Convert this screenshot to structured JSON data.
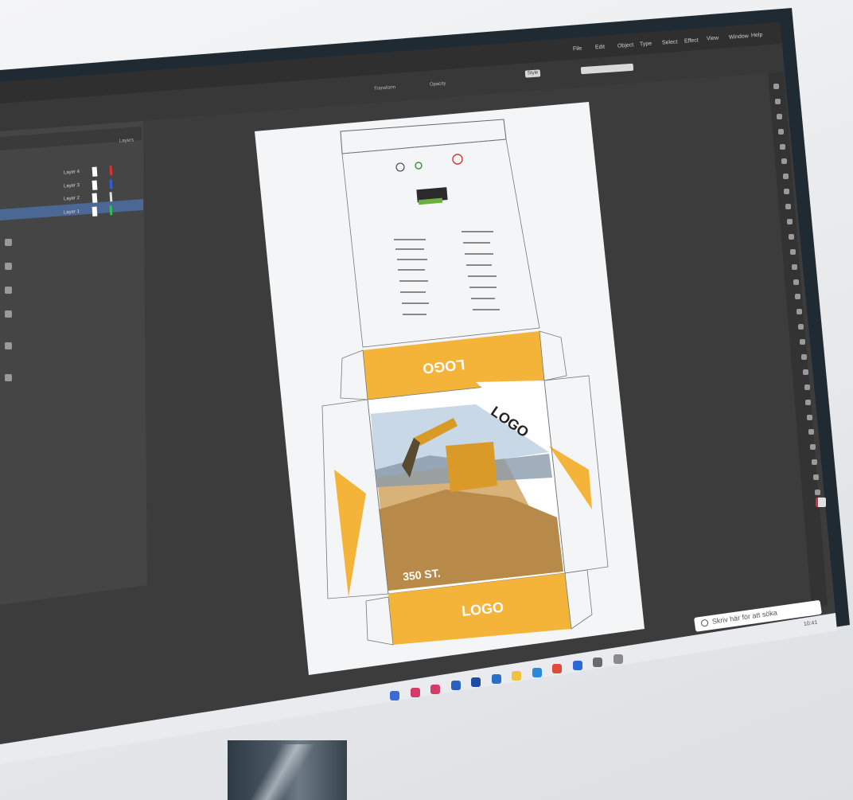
{
  "menu_items": [
    "File",
    "Edit",
    "Object",
    "Type",
    "Select",
    "Effect",
    "View",
    "Window",
    "Help"
  ],
  "control_bar": {
    "transform_label": "Transform",
    "opacity_label": "Opacity",
    "style_label": "Style"
  },
  "layers_panel": {
    "tab_label": "Layers",
    "layers": [
      {
        "name": "Layer 4",
        "color": "#e03030"
      },
      {
        "name": "Layer 3",
        "color": "#3060e0"
      },
      {
        "name": "Layer 2",
        "color": "#e0e0e0"
      },
      {
        "name": "Layer 1",
        "color": "#30c050"
      }
    ]
  },
  "artboard": {
    "top_logo": "LOGO",
    "diag_logo": "LOGO",
    "bottom_logo": "LOGO",
    "count_text": "350 ST.",
    "accent": "#f4b43a"
  },
  "taskbar": {
    "search_placeholder": "Skriv här för att söka",
    "icons": [
      {
        "name": "shield-icon",
        "color": "#3a6bd8"
      },
      {
        "name": "app-red-icon",
        "color": "#d43b6a"
      },
      {
        "name": "app-pink-icon",
        "color": "#d43b6a"
      },
      {
        "name": "app-blue-icon",
        "color": "#2a60c0"
      },
      {
        "name": "app-navy-icon",
        "color": "#1e4aa8"
      },
      {
        "name": "app-teal-icon",
        "color": "#2a70c8"
      },
      {
        "name": "folder-icon",
        "color": "#f2c23e"
      },
      {
        "name": "edge-icon",
        "color": "#2a8ad8"
      },
      {
        "name": "chrome-icon",
        "color": "#e04a3a"
      },
      {
        "name": "mail-icon",
        "color": "#2a6ad8"
      },
      {
        "name": "store-icon",
        "color": "#6a6a6a"
      },
      {
        "name": "desktop-icon",
        "color": "#8a8a8a"
      }
    ]
  },
  "system_tray": {
    "clock": "10:41"
  }
}
